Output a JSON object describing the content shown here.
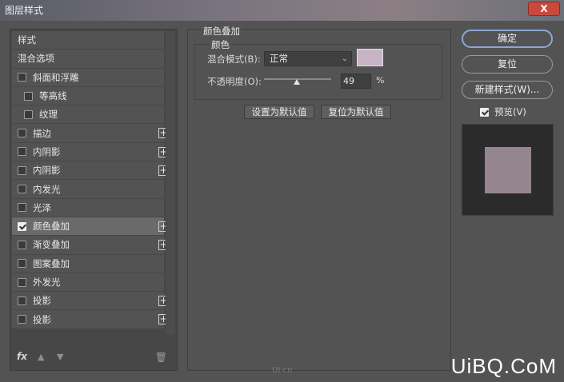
{
  "window": {
    "title": "图层样式",
    "close_label": "X"
  },
  "style_list": {
    "header_style": "样式",
    "header_blend": "混合选项",
    "items": [
      {
        "label": "斜面和浮雕",
        "checked": false,
        "sub": false,
        "plus": false
      },
      {
        "label": "等高线",
        "checked": false,
        "sub": true,
        "plus": false
      },
      {
        "label": "纹理",
        "checked": false,
        "sub": true,
        "plus": false
      },
      {
        "label": "描边",
        "checked": false,
        "sub": false,
        "plus": true
      },
      {
        "label": "内阴影",
        "checked": false,
        "sub": false,
        "plus": true
      },
      {
        "label": "内阴影",
        "checked": false,
        "sub": false,
        "plus": true
      },
      {
        "label": "内发光",
        "checked": false,
        "sub": false,
        "plus": false
      },
      {
        "label": "光泽",
        "checked": false,
        "sub": false,
        "plus": false
      },
      {
        "label": "颜色叠加",
        "checked": true,
        "sub": false,
        "plus": true,
        "selected": true
      },
      {
        "label": "渐变叠加",
        "checked": false,
        "sub": false,
        "plus": true
      },
      {
        "label": "图案叠加",
        "checked": false,
        "sub": false,
        "plus": false
      },
      {
        "label": "外发光",
        "checked": false,
        "sub": false,
        "plus": false
      },
      {
        "label": "投影",
        "checked": false,
        "sub": false,
        "plus": true
      },
      {
        "label": "投影",
        "checked": false,
        "sub": false,
        "plus": true
      }
    ],
    "footer": {
      "fx_label": "fx"
    }
  },
  "color_overlay": {
    "section_title": "颜色叠加",
    "group_title": "颜色",
    "blend_mode_label": "混合模式(B):",
    "blend_mode_value": "正常",
    "overlay_color": "#c8b3c7",
    "opacity_label": "不透明度(O):",
    "opacity_value": "49",
    "opacity_unit": "%",
    "set_default_label": "设置为默认值",
    "reset_default_label": "复位为默认值"
  },
  "actions": {
    "ok_label": "确定",
    "reset_label": "复位",
    "new_style_label": "新建样式(W)...",
    "preview_label": "预览(V)",
    "preview_checked": true
  },
  "preview": {
    "swatch_color": "#95858f"
  },
  "watermark": {
    "small": "UI·cn",
    "brand": "UiBQ.CoM"
  }
}
